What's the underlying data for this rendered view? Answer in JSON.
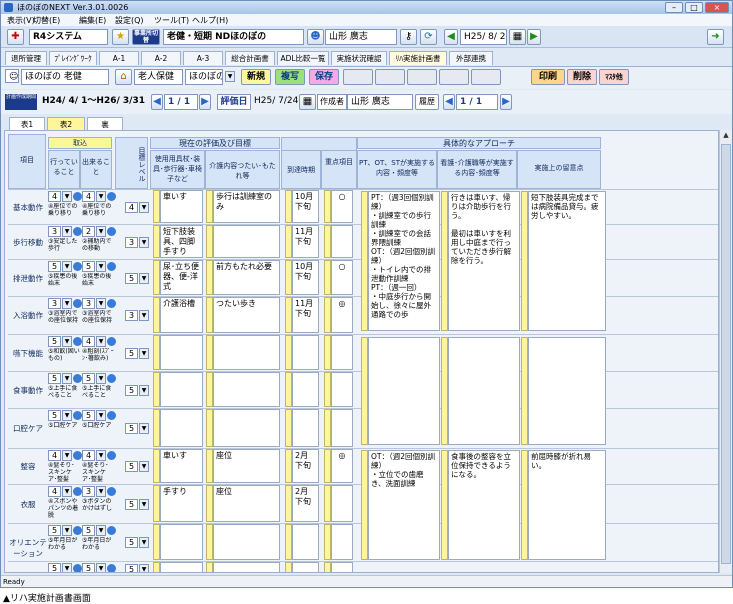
{
  "window": {
    "title": "ほのぼのNEXT Ver.3.01.0026",
    "min": "–",
    "max": "□",
    "close": "×"
  },
  "menu": [
    "表示(V)",
    "切替(E)",
    "編集(E)",
    "設定(Q)",
    "ツール(T)",
    "ヘルプ(H)"
  ],
  "toolbar": {
    "system": "R4システム",
    "office_btn": "事業所切替",
    "service": "老健・短期 NDほのぼの",
    "user": "山形 廣志",
    "date": "H25/ 8/ 2"
  },
  "tabs": [
    "退所管理",
    "ﾌﾟﾚｲﾝｸﾞﾜｰｸ",
    "A-1",
    "A-2",
    "A-3",
    "総合計画書",
    "ADL比較一覧",
    "実施状況確認",
    "ﾘﾊ実施計画書",
    "外部連携"
  ],
  "active_tab_index": 8,
  "row3": {
    "person": "ほのぼの 老健",
    "service": "老人保健",
    "office": "ほのぼの",
    "new": "新規",
    "copy": "複写",
    "save": "保存",
    "print": "印刷",
    "delete": "削除",
    "mask": "ﾏｽﾀ他"
  },
  "row4": {
    "period_label": "計画作成期間",
    "period": "H24/ 4/ 1～H26/ 3/31",
    "page": "1 / 1",
    "eval_label": "評価日",
    "eval_date": "H25/ 7/24",
    "author_label": "作成者",
    "author": "山形 廣志",
    "history": "履歴",
    "page2": "1 / 1"
  },
  "sheet_tabs": [
    "表1",
    "表2",
    "裏"
  ],
  "headers": {
    "item": "項目",
    "torikomi": "取込",
    "doing": "行っていること",
    "can": "出来ること",
    "goal_level": "目標レベル",
    "current": "現在の評価及び目標",
    "tools": "使用用具杖･装具･歩行器･車椅子など",
    "care": "介護内容つたい･もたれ等",
    "period": "到達時期",
    "priority": "重点項目",
    "approach": "具体的なアプローチ",
    "pt": "PT、OT、STが実施する内容・頻度等",
    "nurse": "看護･介護職等が実施する内容･頻度等",
    "notes": "実施上の留意点"
  },
  "rows": [
    {
      "label": "基本動作",
      "d": "4",
      "dt": "④座位での乗り移り",
      "c": "4",
      "ct": "④座位での乗り移り",
      "g": "4",
      "tool": "車いす",
      "care": "歩行は訓練室のみ",
      "per": "10月下旬",
      "pri": "○"
    },
    {
      "label": "歩行移動",
      "d": "3",
      "dt": "③安定した歩行",
      "c": "2",
      "ct": "②補助内での移動",
      "g": "3",
      "tool": "短下肢装具、四脚 手すり",
      "care": "",
      "per": "11月下旬",
      "pri": ""
    },
    {
      "label": "排泄動作",
      "d": "5",
      "dt": "⑤疾患の後始末",
      "c": "5",
      "ct": "⑤疾患の後始末",
      "g": "5",
      "tool": "尿･立ち便器、便-洋式",
      "care": "前方もたれ必要",
      "per": "10月下旬",
      "pri": "○"
    },
    {
      "label": "入浴動作",
      "d": "3",
      "dt": "③浴室内での座位保持",
      "c": "3",
      "ct": "③浴室内での座位保持",
      "g": "3",
      "tool": "介護浴槽",
      "care": "つたい歩き",
      "per": "11月下旬",
      "pri": "◎"
    },
    {
      "label": "嚥下機能",
      "d": "5",
      "dt": "⑤和飲(固いもの)",
      "c": "4",
      "ct": "④粗刻(ｽﾌﾟｰﾝ･箸飲み)",
      "g": "5",
      "tool": "",
      "care": "",
      "per": "",
      "pri": ""
    },
    {
      "label": "食事動作",
      "d": "5",
      "dt": "⑤上手に食べること",
      "c": "5",
      "ct": "⑤上手に食べること",
      "g": "5",
      "tool": "",
      "care": "",
      "per": "",
      "pri": ""
    },
    {
      "label": "口腔ケア",
      "d": "5",
      "dt": "⑤口腔ケア",
      "c": "5",
      "ct": "⑤口腔ケア",
      "g": "5",
      "tool": "",
      "care": "",
      "per": "",
      "pri": ""
    },
    {
      "label": "整容",
      "d": "4",
      "dt": "④髭そり･スキンケア･整髪",
      "c": "4",
      "ct": "④髭そり･スキンケア･整髪",
      "g": "5",
      "tool": "車いす",
      "care": "座位",
      "per": "2月下旬",
      "pri": "◎"
    },
    {
      "label": "衣服",
      "d": "4",
      "dt": "④ズボンやパンツの着脱",
      "c": "3",
      "ct": "③ボタンのかけはずし",
      "g": "5",
      "tool": "手すり",
      "care": "座位",
      "per": "2月下旬",
      "pri": ""
    },
    {
      "label": "オリエンテーション",
      "d": "5",
      "dt": "⑤年月日がわかる",
      "c": "5",
      "ct": "⑤年月日がわかる",
      "g": "5",
      "tool": "",
      "care": "",
      "per": "",
      "pri": ""
    },
    {
      "label": "",
      "d": "5",
      "dt": "",
      "c": "5",
      "ct": "",
      "g": "5",
      "tool": "",
      "care": "",
      "per": "",
      "pri": ""
    }
  ],
  "approach_pt_1": "PT：（週3回個別訓練）\n・訓練室での歩行訓練\n・訓練室での会話界隈訓練\nOT：（週2回個別訓練）\n・トイレ内での排泄動作訓練\nPT：（週一回）\n・中庭歩行から開始し、徐々に屋外通路での歩",
  "approach_nurse_1": "行きは車いす、帰りは介助歩行を行う。\n\n最初は車いすを利用し中庭まで行っていただき歩行解除を行う。",
  "approach_notes_1": "短下肢装具完成までは病院備品貸与。疲労しやすい。",
  "approach_pt_2": "OT：（週2回個別訓練）\n・立位での歯磨き、洗面訓練",
  "approach_nurse_2": "食事後の整容を立位保持できるようになる。",
  "approach_notes_2": "前屈時膝が折れ易い。",
  "status": "Ready",
  "caption": "▲リハ実施計画書画面"
}
